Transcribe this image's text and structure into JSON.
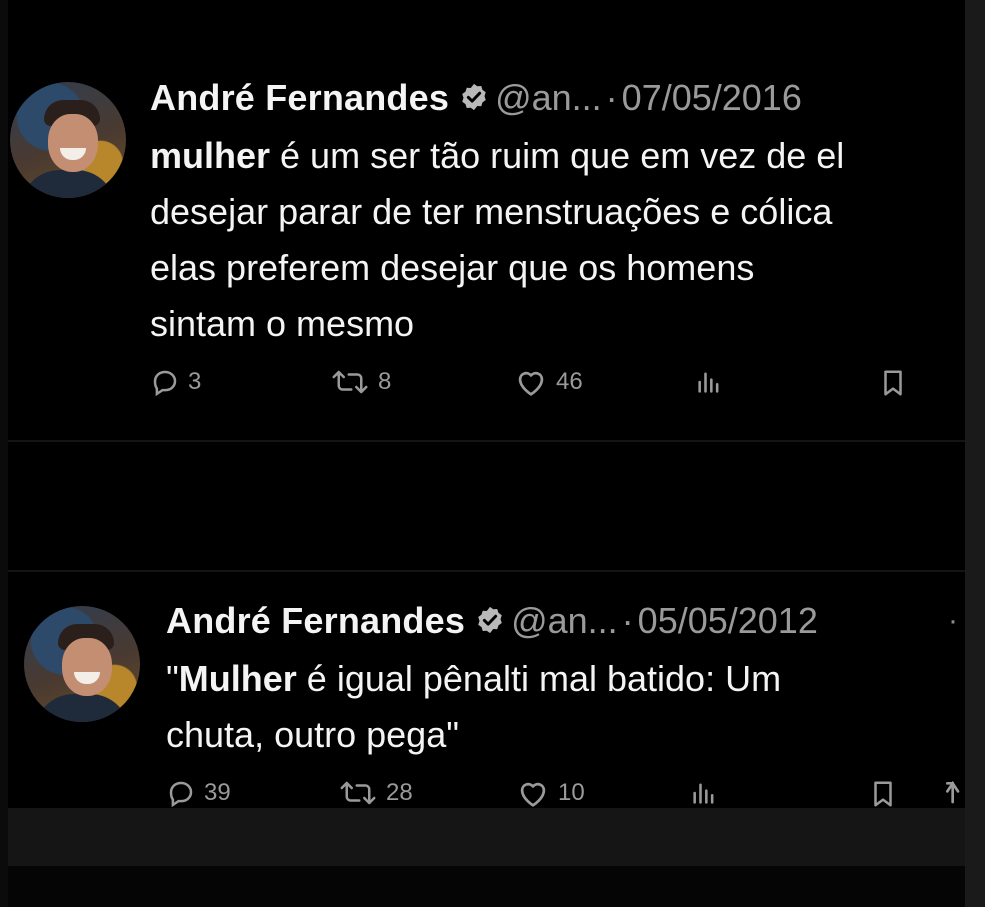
{
  "tweets": [
    {
      "author_name": "André Fernandes",
      "handle": "@an...",
      "separator": "·",
      "date": "07/05/2016",
      "text_bold": "mulher",
      "text_lines": [
        " é um ser tão ruim que em vez de el",
        "desejar parar de ter menstruações e cólica",
        "elas preferem desejar que os homens",
        "sintam o mesmo"
      ],
      "actions": {
        "replies": "3",
        "reposts": "8",
        "likes": "46"
      },
      "icons": [
        "verified-badge-icon",
        "reply-icon",
        "repost-icon",
        "like-icon",
        "views-icon",
        "bookmark-icon"
      ]
    },
    {
      "author_name": "André Fernandes",
      "handle": "@an...",
      "separator": "·",
      "date": "05/05/2012",
      "more": "·",
      "text_open_quote": "\"",
      "text_bold": "Mulher",
      "text_lines": [
        " é igual pênalti mal batido: Um",
        "chuta, outro pega\""
      ],
      "actions": {
        "replies": "39",
        "reposts": "28",
        "likes": "10"
      },
      "icons": [
        "verified-badge-icon",
        "reply-icon",
        "repost-icon",
        "like-icon",
        "views-icon",
        "bookmark-icon",
        "share-icon"
      ]
    }
  ],
  "colors": {
    "background": "#000000",
    "text": "#f4f4f4",
    "muted": "#9a9a9a"
  }
}
